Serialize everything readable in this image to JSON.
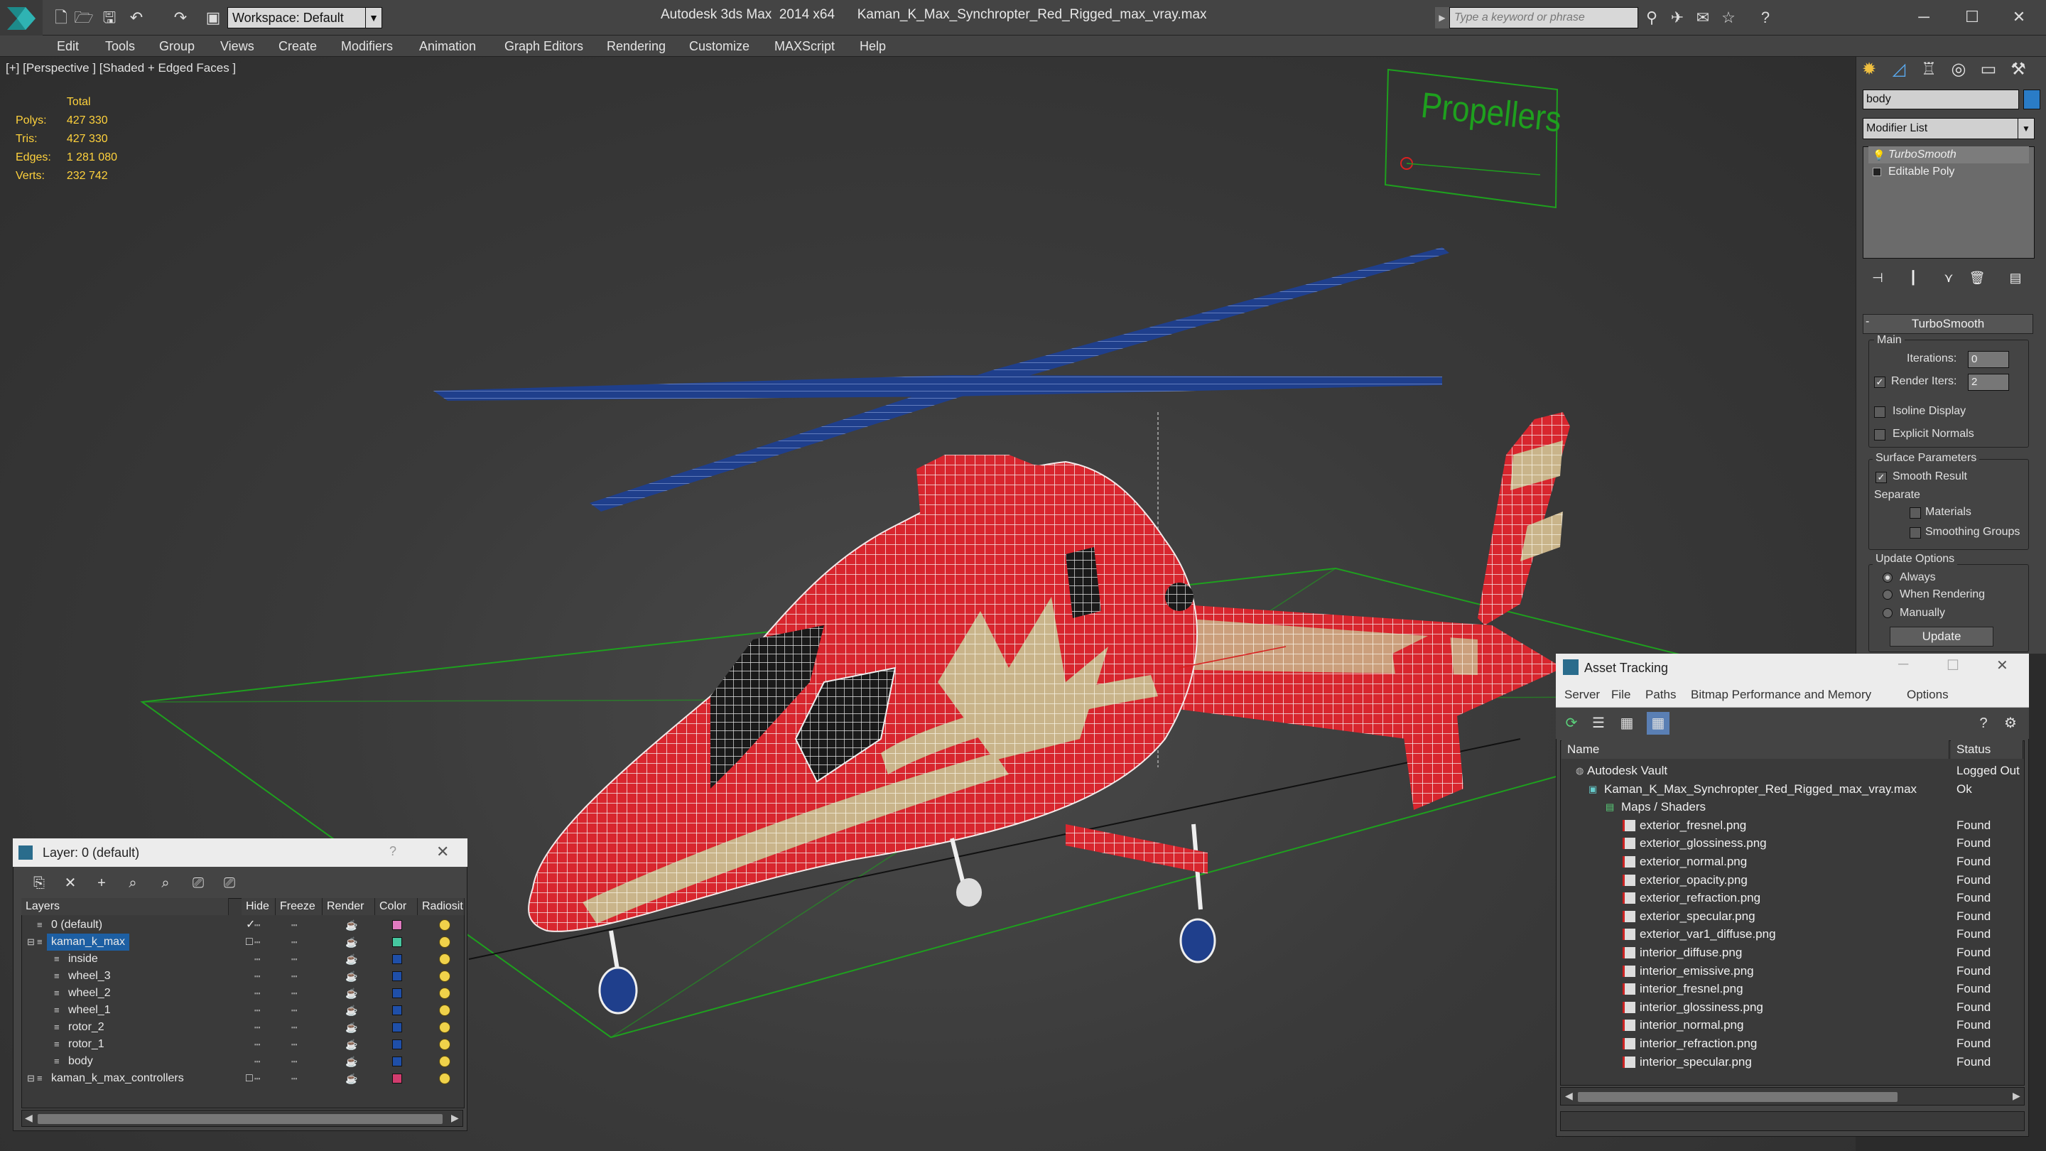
{
  "app": {
    "title": "Autodesk 3ds Max  2014 x64",
    "file_name": "Kaman_K_Max_Synchropter_Red_Rigged_max_vray.max",
    "workspace": "Workspace: Default",
    "search_placeholder": "Type a keyword or phrase"
  },
  "menu": [
    "Edit",
    "Tools",
    "Group",
    "Views",
    "Create",
    "Modifiers",
    "Animation",
    "Graph Editors",
    "Rendering",
    "Customize",
    "MAXScript",
    "Help"
  ],
  "viewport": {
    "label": "[+] [Perspective ] [Shaded + Edged Faces ]",
    "stats": {
      "header": "Total",
      "rows": [
        {
          "label": "Polys:",
          "value": "427 330"
        },
        {
          "label": "Tris:",
          "value": "427 330"
        },
        {
          "label": "Edges:",
          "value": "1 281 080"
        },
        {
          "label": "Verts:",
          "value": "232 742"
        }
      ]
    },
    "sign_text": "Propellers"
  },
  "command_panel": {
    "object_name": "body",
    "object_color": "#2a7cc7",
    "modifier_list": "Modifier List",
    "stack": [
      "TurboSmooth",
      "Editable Poly"
    ],
    "rollout": "TurboSmooth",
    "main_group": "Main",
    "iterations_label": "Iterations:",
    "iterations_value": "0",
    "render_iters_label": "Render Iters:",
    "render_iters_value": "2",
    "isoline": "Isoline Display",
    "explicit_normals": "Explicit Normals",
    "surface_group": "Surface Parameters",
    "smooth_result": "Smooth Result",
    "separate": "Separate",
    "materials": "Materials",
    "smoothing_groups": "Smoothing Groups",
    "update_group": "Update Options",
    "always": "Always",
    "when_rendering": "When Rendering",
    "manually": "Manually",
    "update_button": "Update"
  },
  "layer_dialog": {
    "title": "Layer: 0 (default)",
    "help": "?",
    "columns": [
      "Layers",
      "Hide",
      "Freeze",
      "Render",
      "Color",
      "Radiosit"
    ],
    "rows": [
      {
        "name": "0 (default)",
        "color": "#e07ac0",
        "check": "✓"
      },
      {
        "name": "kaman_k_max",
        "color": "#46c8a0",
        "check": "□"
      },
      {
        "name": "inside",
        "color": "#1f4fa8"
      },
      {
        "name": "wheel_3",
        "color": "#1f4fa8"
      },
      {
        "name": "wheel_2",
        "color": "#1f4fa8"
      },
      {
        "name": "wheel_1",
        "color": "#1f4fa8"
      },
      {
        "name": "rotor_2",
        "color": "#1f4fa8"
      },
      {
        "name": "rotor_1",
        "color": "#1f4fa8"
      },
      {
        "name": "body",
        "color": "#1f4fa8"
      },
      {
        "name": "kaman_k_max_controllers",
        "color": "#d23c6e",
        "check": "□"
      }
    ]
  },
  "asset_dialog": {
    "title": "Asset Tracking",
    "menu": [
      "Server",
      "File",
      "Paths",
      "Bitmap Performance and Memory",
      "Options"
    ],
    "columns": [
      "Name",
      "Status"
    ],
    "rows": [
      {
        "name": "Autodesk Vault",
        "status": "Logged Out"
      },
      {
        "name": "Kaman_K_Max_Synchropter_Red_Rigged_max_vray.max",
        "status": "Ok"
      },
      {
        "name": "Maps / Shaders",
        "status": ""
      },
      {
        "name": "exterior_fresnel.png",
        "status": "Found"
      },
      {
        "name": "exterior_glossiness.png",
        "status": "Found"
      },
      {
        "name": "exterior_normal.png",
        "status": "Found"
      },
      {
        "name": "exterior_opacity.png",
        "status": "Found"
      },
      {
        "name": "exterior_refraction.png",
        "status": "Found"
      },
      {
        "name": "exterior_specular.png",
        "status": "Found"
      },
      {
        "name": "exterior_var1_diffuse.png",
        "status": "Found"
      },
      {
        "name": "interior_diffuse.png",
        "status": "Found"
      },
      {
        "name": "interior_emissive.png",
        "status": "Found"
      },
      {
        "name": "interior_fresnel.png",
        "status": "Found"
      },
      {
        "name": "interior_glossiness.png",
        "status": "Found"
      },
      {
        "name": "interior_normal.png",
        "status": "Found"
      },
      {
        "name": "interior_refraction.png",
        "status": "Found"
      },
      {
        "name": "interior_specular.png",
        "status": "Found"
      }
    ]
  }
}
